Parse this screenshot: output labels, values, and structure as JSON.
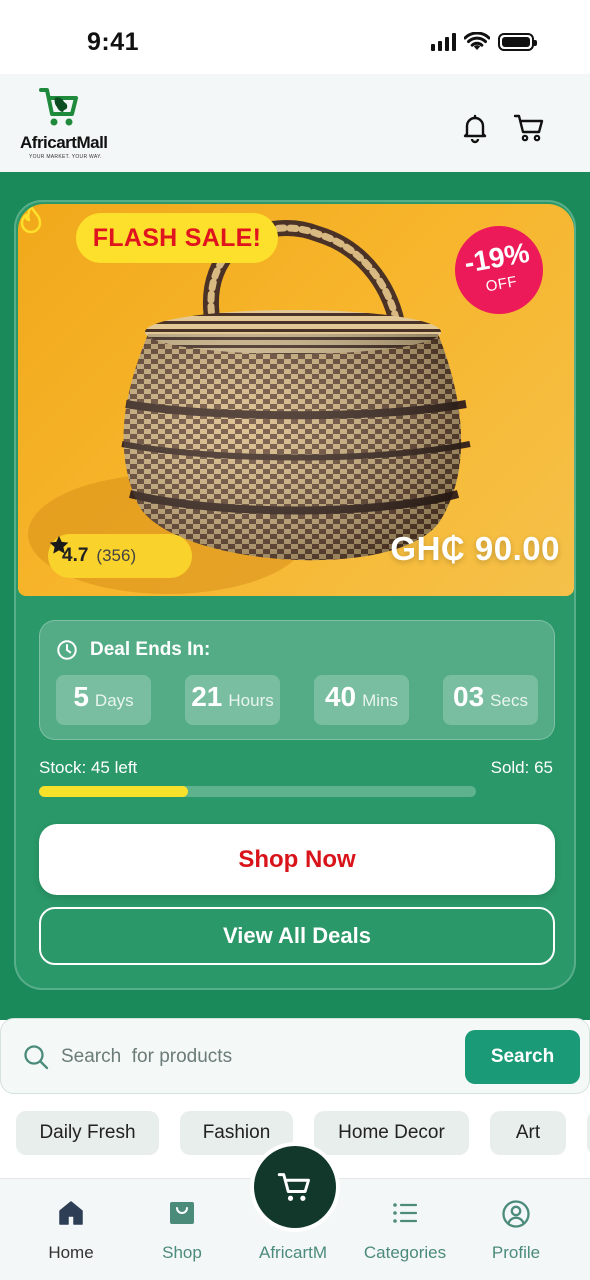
{
  "status_bar": {
    "time": "9:41"
  },
  "header": {
    "logo_name": "AfricartMall",
    "logo_tagline": "YOUR MARKET. YOUR WAY."
  },
  "deal": {
    "badge": "FLASH SALE!",
    "discount_pct": "-19%",
    "discount_off": "OFF",
    "rating": "4.7",
    "rating_count": "(356)",
    "price": "GH₵ 90.00",
    "countdown_title": "Deal Ends In:",
    "countdown": [
      {
        "value": "5",
        "unit": "Days"
      },
      {
        "value": "21",
        "unit": "Hours"
      },
      {
        "value": "40",
        "unit": "Mins"
      },
      {
        "value": "03",
        "unit": "Secs"
      }
    ],
    "stock_label": "Stock: 45 left",
    "sold_label": "Sold: 65",
    "stock_progress": 0.34,
    "shop_now": "Shop Now",
    "view_all": "View All Deals"
  },
  "search": {
    "placeholder": "Search  for products",
    "button": "Search"
  },
  "categories": [
    "Daily Fresh",
    "Fashion",
    "Home Decor",
    "Art"
  ],
  "bottom_nav": [
    {
      "label": "Home",
      "icon": "home-icon",
      "active": true
    },
    {
      "label": "Shop",
      "icon": "shopping-bag-icon",
      "active": false
    },
    {
      "label": "AfricartM",
      "icon": "cart-icon",
      "active": false
    },
    {
      "label": "Categories",
      "icon": "list-icon",
      "active": false
    },
    {
      "label": "Profile",
      "icon": "user-icon",
      "active": false
    }
  ],
  "colors": {
    "brand_green": "#1b8a5a",
    "accent_yellow": "#fde02b",
    "flash_red": "#e0141e",
    "discount_pink": "#ec1a58",
    "search_teal": "#1a9a77",
    "fab_dark": "#12382c"
  }
}
